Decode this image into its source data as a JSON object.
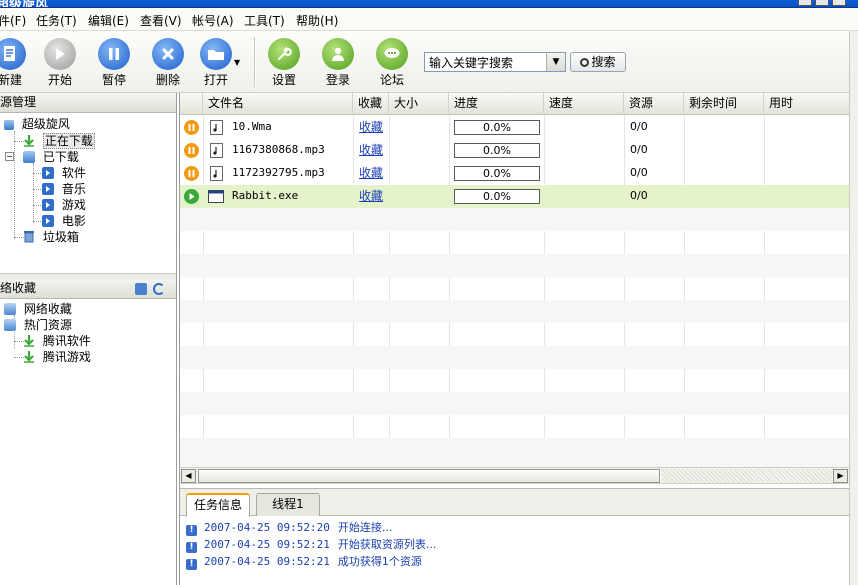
{
  "window": {
    "title": "超级旋风"
  },
  "menu": [
    "件(F)",
    "任务(T)",
    "编辑(E)",
    "查看(V)",
    "帐号(A)",
    "工具(T)",
    "帮助(H)"
  ],
  "toolbar": {
    "buttons": [
      {
        "label": "新建",
        "icon": "new-icon"
      },
      {
        "label": "开始",
        "icon": "play-icon"
      },
      {
        "label": "暂停",
        "icon": "pause-icon"
      },
      {
        "label": "删除",
        "icon": "delete-icon"
      },
      {
        "label": "打开",
        "icon": "open-folder-icon"
      },
      {
        "label": "设置",
        "icon": "wrench-icon"
      },
      {
        "label": "登录",
        "icon": "user-icon"
      },
      {
        "label": "论坛",
        "icon": "chat-icon"
      }
    ],
    "search_placeholder": "输入关键字搜索",
    "search_button": "搜索"
  },
  "resource_panel": {
    "header": "源管理",
    "tree": [
      {
        "label": "超级旋风",
        "icon": "app-icon"
      },
      {
        "label": "正在下载",
        "icon": "download-arrow-icon",
        "selected": true
      },
      {
        "label": "已下载",
        "icon": "downloaded-box-icon"
      },
      {
        "label": "软件",
        "icon": "category-icon"
      },
      {
        "label": "音乐",
        "icon": "category-icon"
      },
      {
        "label": "游戏",
        "icon": "category-icon"
      },
      {
        "label": "电影",
        "icon": "category-icon"
      },
      {
        "label": "垃圾箱",
        "icon": "trash-icon"
      }
    ]
  },
  "favorites_panel": {
    "header": "络收藏",
    "tree": [
      {
        "label": "网络收藏",
        "icon": "net-folder-icon"
      },
      {
        "label": "热门资源",
        "icon": "net-folder-icon"
      },
      {
        "label": "腾讯软件",
        "icon": "download-arrow-icon"
      },
      {
        "label": "腾讯游戏",
        "icon": "download-arrow-icon"
      }
    ]
  },
  "grid": {
    "columns": [
      "文件名",
      "收藏",
      "大小",
      "进度",
      "速度",
      "资源",
      "剩余时间",
      "用时"
    ],
    "rows": [
      {
        "status": "paused",
        "file": "10.Wma",
        "favorite": "收藏",
        "size": "",
        "progress": "0.0%",
        "speed": "",
        "resource": "0/0",
        "remaining": "",
        "elapsed": ""
      },
      {
        "status": "paused",
        "file": "1167380868.mp3",
        "favorite": "收藏",
        "size": "",
        "progress": "0.0%",
        "speed": "",
        "resource": "0/0",
        "remaining": "",
        "elapsed": ""
      },
      {
        "status": "paused",
        "file": "1172392795.mp3",
        "favorite": "收藏",
        "size": "",
        "progress": "0.0%",
        "speed": "",
        "resource": "0/0",
        "remaining": "",
        "elapsed": ""
      },
      {
        "status": "running",
        "file": "Rabbit.exe",
        "favorite": "收藏",
        "size": "",
        "progress": "0.0%",
        "speed": "",
        "resource": "0/0",
        "remaining": "",
        "elapsed": ""
      }
    ]
  },
  "bottom": {
    "tabs": [
      "任务信息",
      "线程1"
    ],
    "log": [
      {
        "time": "2007-04-25 09:52:20",
        "msg": "开始连接..."
      },
      {
        "time": "2007-04-25 09:52:21",
        "msg": "开始获取资源列表..."
      },
      {
        "time": "2007-04-25 09:52:21",
        "msg": "成功获得1个资源"
      }
    ]
  },
  "colors": {
    "paused": "#f19a12",
    "running": "#3aa83a",
    "selected_row": "#e4f3c9",
    "link": "#1d3fb8",
    "accent_tab": "#f0a000"
  }
}
